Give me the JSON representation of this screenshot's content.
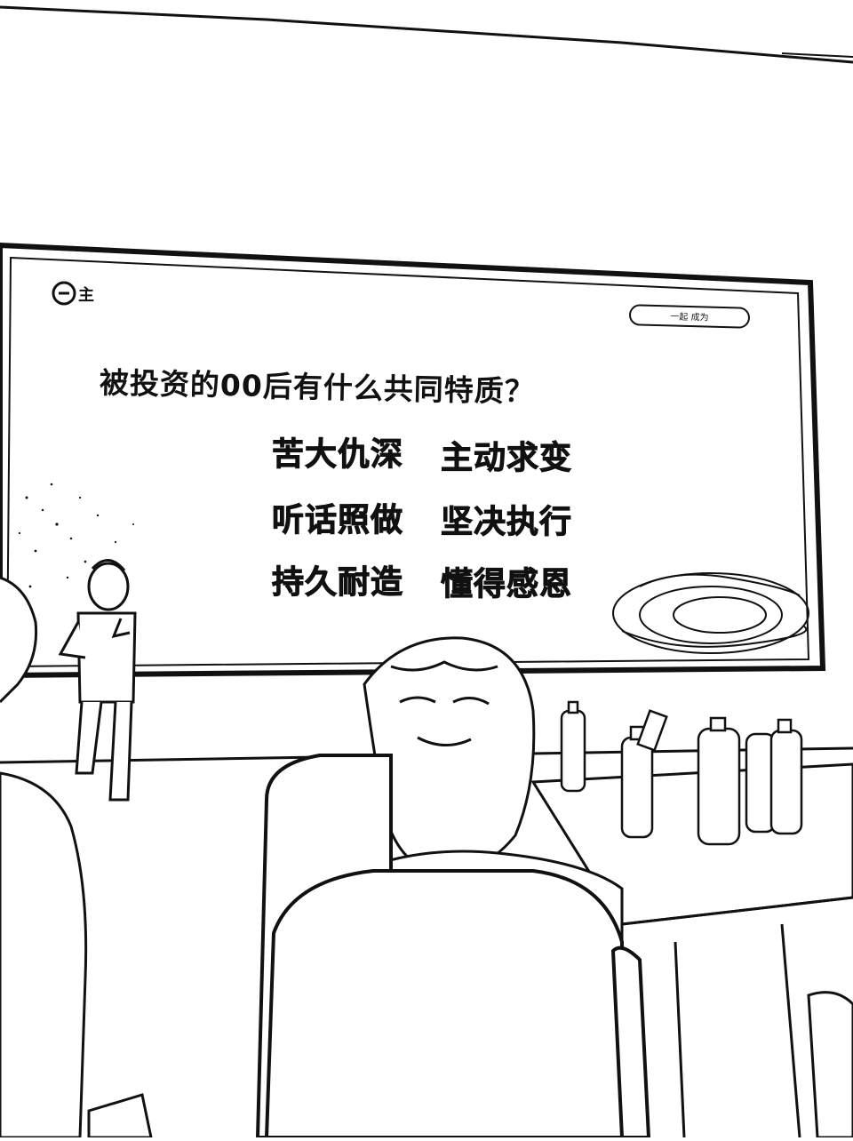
{
  "slide": {
    "logo_text": "主",
    "badge_text": "一起  成为",
    "question": "被投资的00后有什么共同特质？",
    "traits": [
      "苦大仇深",
      "主动求变",
      "听话照做",
      "坚决执行",
      "持久耐造",
      "懂得感恩"
    ]
  },
  "colors": {
    "ink": "#111111",
    "paper": "#ffffff"
  }
}
